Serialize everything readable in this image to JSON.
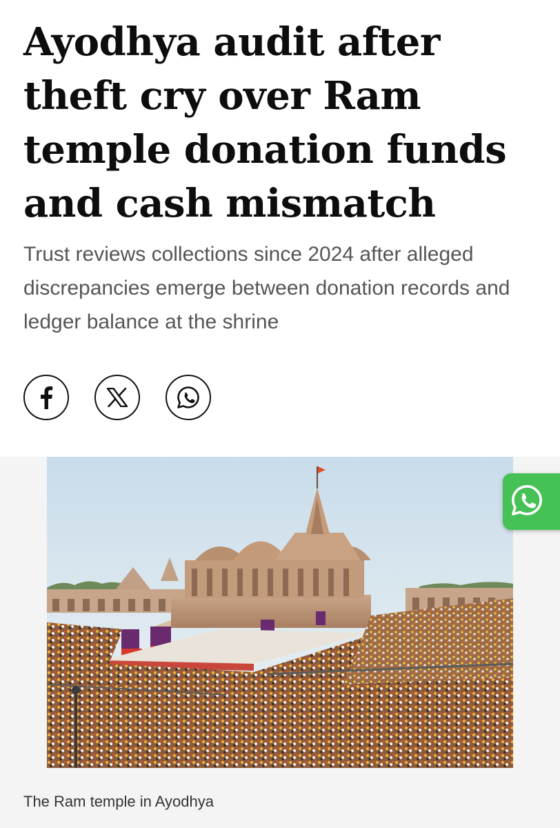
{
  "article": {
    "headline": "Ayodhya audit after theft cry over Ram temple donation funds and cash mismatch",
    "summary": "Trust reviews collections since 2024 after alleged discrepancies emerge between donation records and ledger balance at the shrine"
  },
  "share": {
    "buttons": [
      {
        "network": "facebook",
        "icon": "facebook-icon"
      },
      {
        "network": "x",
        "icon": "x-icon"
      },
      {
        "network": "whatsapp",
        "icon": "whatsapp-icon"
      }
    ]
  },
  "figure": {
    "caption": "The Ram temple in Ayodhya",
    "image_subject": "temple-crowd-photo"
  },
  "floating_button": {
    "icon": "whatsapp-icon",
    "color": "#45c155"
  }
}
